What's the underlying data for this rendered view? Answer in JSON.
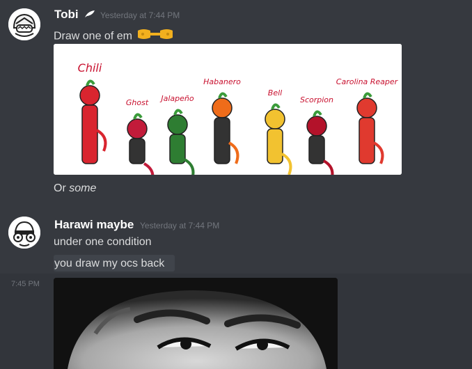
{
  "messages": [
    {
      "username": "Tobi",
      "timestamp": "Yesterday at 7:44 PM",
      "lines": [
        "Draw one of em"
      ],
      "emoji": "pointing-fingers-emoji",
      "image_labels": [
        "Chili",
        "Ghost",
        "Jalapeño",
        "Habanero",
        "Bell",
        "Scorpion",
        "Carolina Reaper"
      ]
    },
    {
      "lines": [
        "Or ",
        "some"
      ]
    },
    {
      "username": "Harawi maybe",
      "timestamp": "Yesterday at 7:44 PM",
      "lines": [
        "under one condition",
        "you draw my ocs back"
      ]
    }
  ],
  "side_time": "7:45 PM",
  "colors": {
    "background": "#36393f",
    "username": "#ffffff",
    "timestamp": "#72767d",
    "text": "#dcddde"
  }
}
